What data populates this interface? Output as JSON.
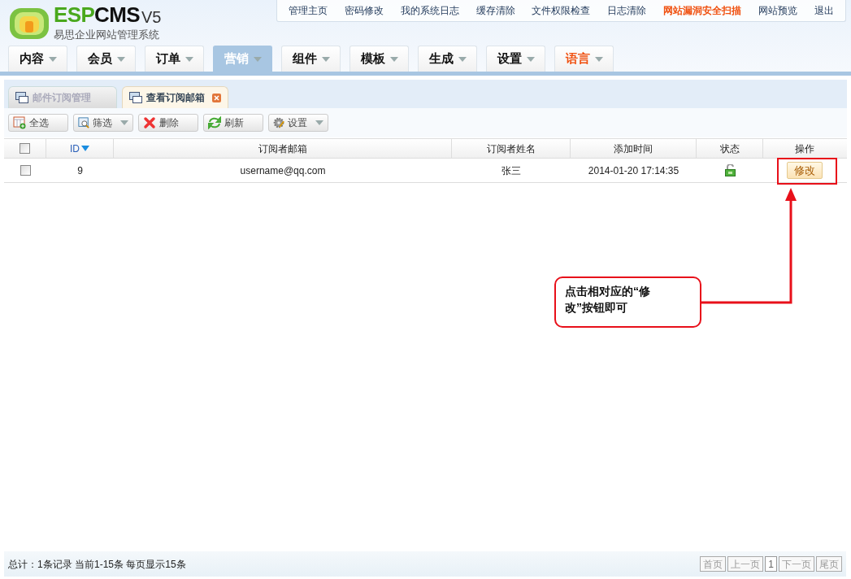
{
  "logo": {
    "brand_green": "ESP",
    "brand_dark": "CMS",
    "version": "V5",
    "subtitle": "易思企业网站管理系统"
  },
  "top_links": [
    {
      "label": "管理主页",
      "highlight": false
    },
    {
      "label": "密码修改",
      "highlight": false
    },
    {
      "label": "我的系统日志",
      "highlight": false
    },
    {
      "label": "缓存清除",
      "highlight": false
    },
    {
      "label": "文件权限检查",
      "highlight": false
    },
    {
      "label": "日志清除",
      "highlight": false
    },
    {
      "label": "网站漏洞安全扫描",
      "highlight": true
    },
    {
      "label": "网站预览",
      "highlight": false
    },
    {
      "label": "退出",
      "highlight": false
    }
  ],
  "nav_tabs": [
    {
      "label": "内容",
      "selected": false,
      "highlight": false
    },
    {
      "label": "会员",
      "selected": false,
      "highlight": false
    },
    {
      "label": "订单",
      "selected": false,
      "highlight": false
    },
    {
      "label": "营销",
      "selected": true,
      "highlight": false
    },
    {
      "label": "组件",
      "selected": false,
      "highlight": false
    },
    {
      "label": "模板",
      "selected": false,
      "highlight": false
    },
    {
      "label": "生成",
      "selected": false,
      "highlight": false
    },
    {
      "label": "设置",
      "selected": false,
      "highlight": false
    },
    {
      "label": "语言",
      "selected": false,
      "highlight": true
    }
  ],
  "page_tabs": [
    {
      "label": "邮件订阅管理",
      "selected": false,
      "closable": false
    },
    {
      "label": "查看订阅邮箱",
      "selected": true,
      "closable": true
    }
  ],
  "toolbar": [
    {
      "kind": "select-all",
      "label": "全选",
      "dropdown": false
    },
    {
      "kind": "filter",
      "label": "筛选",
      "dropdown": true
    },
    {
      "kind": "delete",
      "label": "删除",
      "dropdown": false
    },
    {
      "kind": "refresh",
      "label": "刷新",
      "dropdown": false
    },
    {
      "kind": "settings",
      "label": "设置",
      "dropdown": true
    }
  ],
  "table": {
    "header_checked": false,
    "columns": [
      {
        "label": "ID",
        "sorted": true
      },
      {
        "label": "订阅者邮箱",
        "sorted": false
      },
      {
        "label": "订阅者姓名",
        "sorted": false
      },
      {
        "label": "添加时间",
        "sorted": false
      },
      {
        "label": "状态",
        "sorted": false
      },
      {
        "label": "操作",
        "sorted": false
      }
    ],
    "rows": [
      {
        "checked": false,
        "id": "9",
        "email": "username@qq.com",
        "name": "张三",
        "time": "2014-01-20 17:14:35",
        "locked": false,
        "action": "修改"
      }
    ]
  },
  "callout": {
    "text": "点击相对应的“修改”按钮即可"
  },
  "footer": {
    "summary": "总计：1条记录 当前1-15条 每页显示15条",
    "pages": [
      {
        "label": "首页",
        "selected": false
      },
      {
        "label": "上一页",
        "selected": false
      },
      {
        "label": "1",
        "selected": true
      },
      {
        "label": "下一页",
        "selected": false
      },
      {
        "label": "尾页",
        "selected": false
      }
    ]
  }
}
